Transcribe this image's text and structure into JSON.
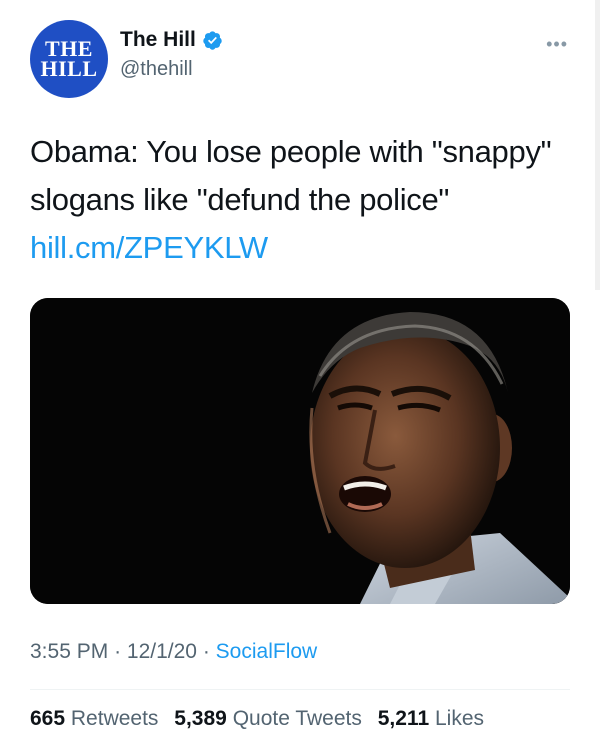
{
  "account": {
    "logo_lines": [
      "THE",
      "HILL"
    ],
    "display_name": "The Hill",
    "handle": "@thehill",
    "verified": true,
    "verified_icon": "verified-badge-icon",
    "more_icon": "more-dots-icon",
    "more_glyph": "•••"
  },
  "tweet": {
    "text": "Obama: You lose people with \"snappy\" slogans like \"defund the police\" ",
    "link_text": "hill.cm/ZPEYKLW"
  },
  "media": {
    "description_icon": "photo"
  },
  "meta": {
    "time": "3:55 PM",
    "separator": "·",
    "date": "12/1/20",
    "source": "SocialFlow"
  },
  "stats": {
    "retweets_count": "665",
    "retweets_label": "Retweets",
    "quotes_count": "5,389",
    "quotes_label": "Quote Tweets",
    "likes_count": "5,211",
    "likes_label": "Likes"
  },
  "colors": {
    "brand_blue": "#1f4fc4",
    "link_blue": "#1d9bf0",
    "text_primary": "#0f1419",
    "text_secondary": "#536471"
  }
}
